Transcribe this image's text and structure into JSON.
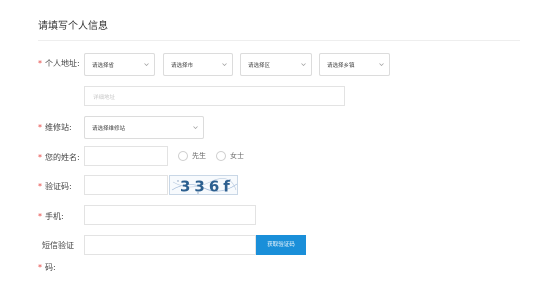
{
  "page": {
    "title": "请填写个人信息"
  },
  "address": {
    "label": "个人地址:",
    "province_placeholder": "请选择省",
    "city_placeholder": "请选择市",
    "district_placeholder": "请选择区",
    "town_placeholder": "请选择乡镇",
    "detail_placeholder": "详细地址"
  },
  "station": {
    "label": "维修站:",
    "placeholder": "请选择维修站"
  },
  "name": {
    "label": "您的姓名:",
    "option_mr": "先生",
    "option_ms": "女士"
  },
  "captcha": {
    "label": "验证码:",
    "image_text": "336f"
  },
  "phone": {
    "label": "手机:"
  },
  "sms": {
    "label_line1": "短信验证",
    "label_line2": "码:",
    "button_label": "获取验证码"
  },
  "colors": {
    "accent": "#1a8fd9",
    "required_star": "#e64340"
  }
}
